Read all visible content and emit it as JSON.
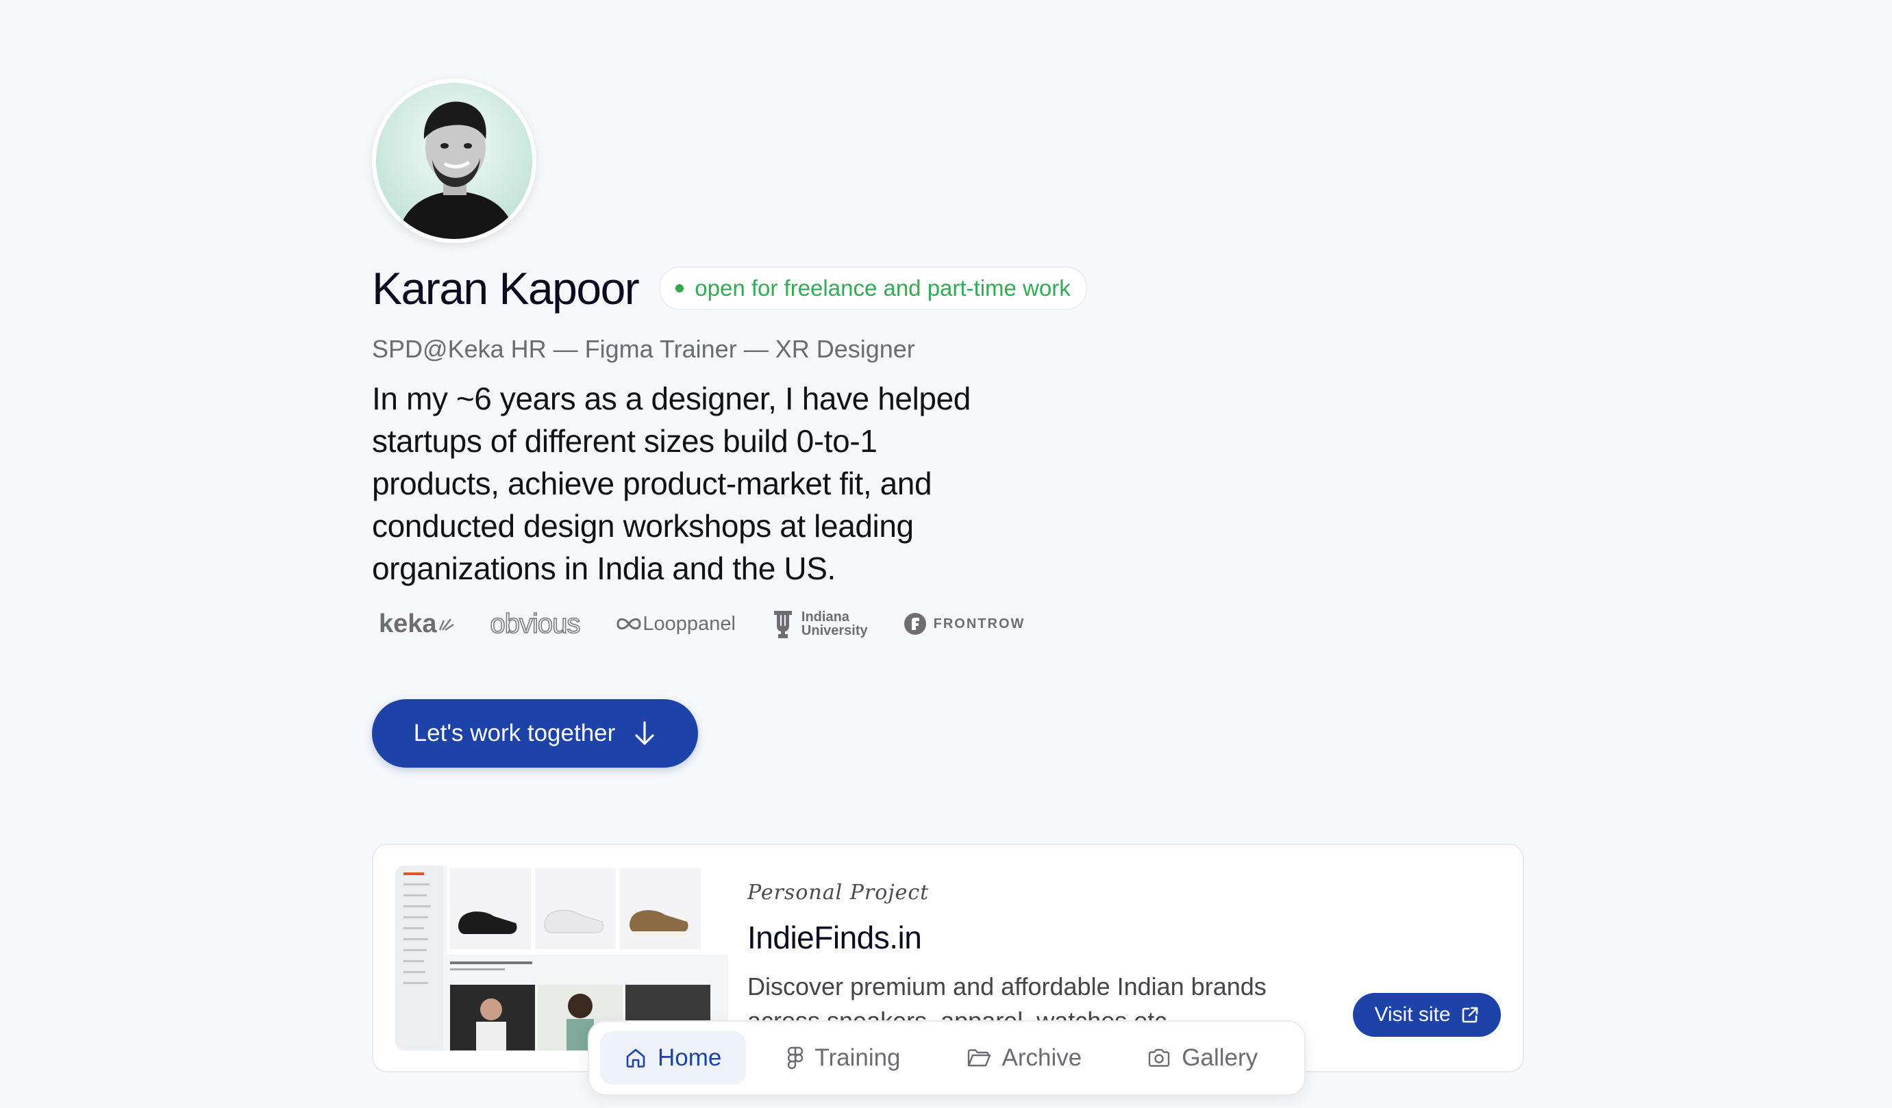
{
  "profile": {
    "name": "Karan Kapoor",
    "status": "open for freelance and part-time work",
    "subtitle": "SPD@Keka HR — Figma Trainer — XR Designer",
    "bio": "In my ~6 years as a designer, I have helped startups of different sizes build 0-to-1 products, achieve product-market fit, and conducted design workshops at leading organizations in India and the US.",
    "avatar_icon": "profile-photo",
    "status_color": "#2fa84f"
  },
  "logos": {
    "keka": "keka",
    "obvious": "obvious",
    "looppanel": "Looppanel",
    "indiana_line1": "Indiana",
    "indiana_line2": "University",
    "frontrow": "FRONTROW"
  },
  "cta": {
    "label": "Let's work together",
    "icon": "arrow-down-icon"
  },
  "project": {
    "tag": "Personal Project",
    "title": "IndieFinds.in",
    "description": "Discover premium and affordable Indian brands across sneakers, apparel, watches etc.",
    "visit_label": "Visit site",
    "visit_icon": "external-link-icon"
  },
  "nav": {
    "items": [
      {
        "label": "Home",
        "icon": "home-icon",
        "active": true
      },
      {
        "label": "Training",
        "icon": "figma-icon",
        "active": false
      },
      {
        "label": "Archive",
        "icon": "folder-icon",
        "active": false
      },
      {
        "label": "Gallery",
        "icon": "camera-icon",
        "active": false
      }
    ]
  },
  "colors": {
    "accent": "#1d43a8",
    "background": "#f7f8fb"
  }
}
